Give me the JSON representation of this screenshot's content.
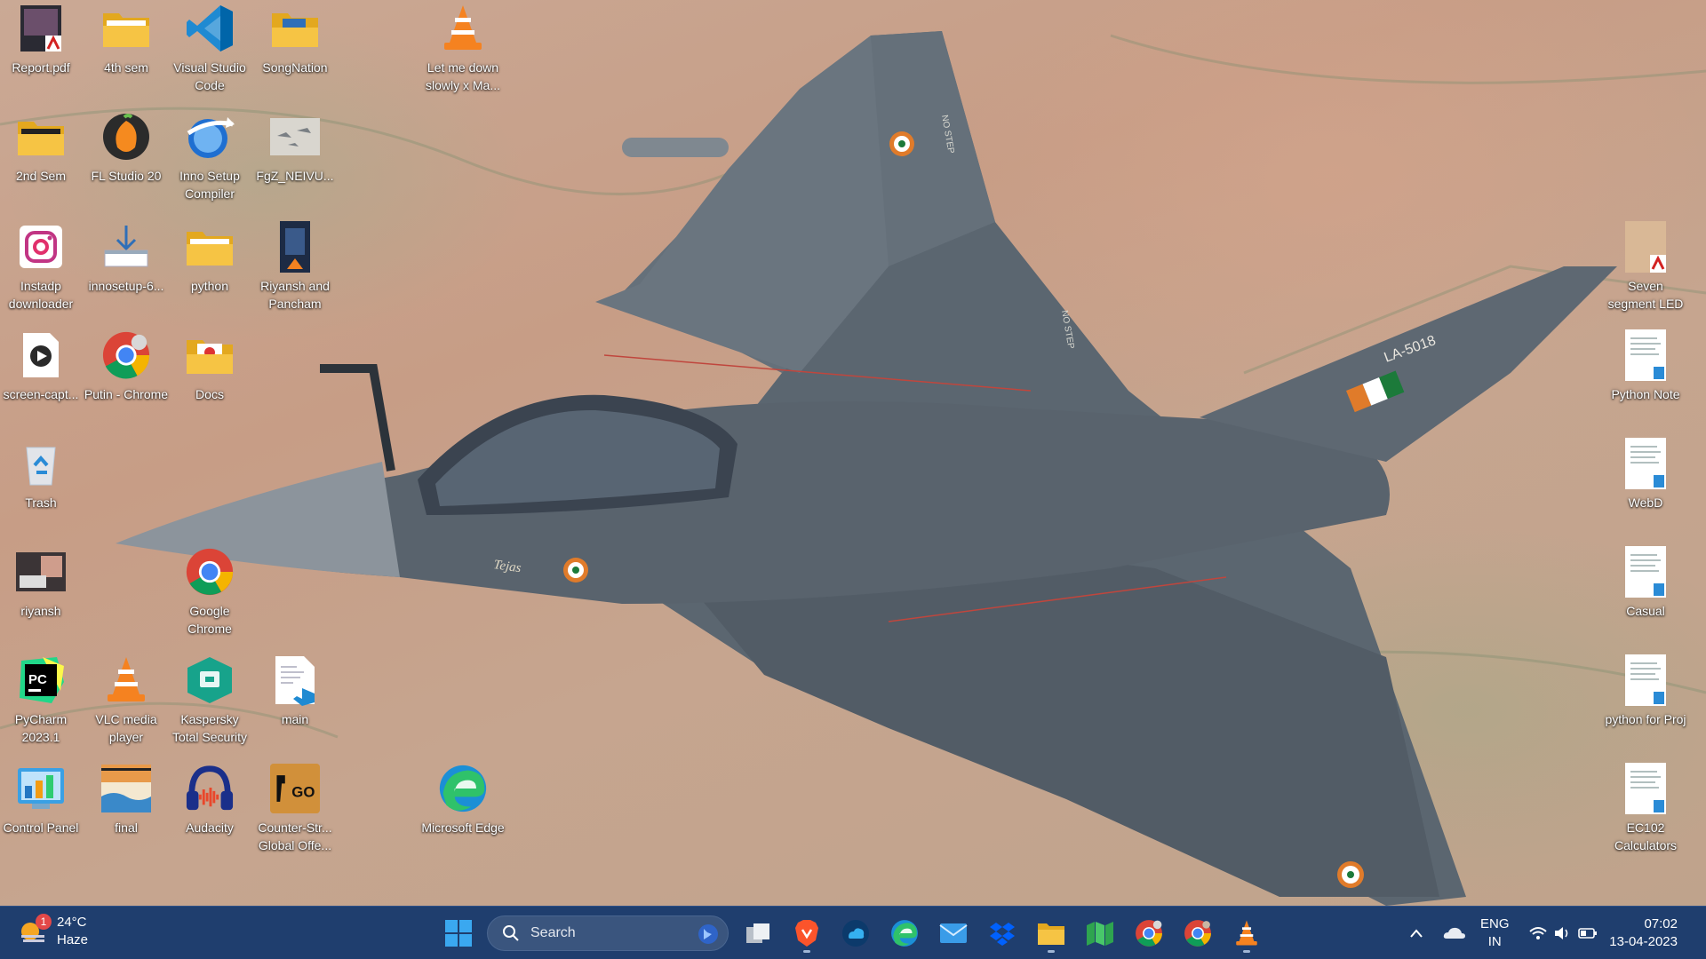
{
  "desktop": {
    "icons": {
      "report_pdf": "Report.pdf",
      "sem4": "4th sem",
      "vscode": "Visual Studio Code",
      "songnation": "SongNation",
      "vlc_song": "Let me down slowly x Ma...",
      "sem2": "2nd Sem",
      "flstudio": "FL Studio 20",
      "innosetup_compiler": "Inno Setup Compiler",
      "fgz": "FgZ_NEIVU...",
      "instadp": "Instadp downloader",
      "innosetup_installer": "innosetup-6...",
      "python_folder": "python",
      "riyansh_pancham": "Riyansh and Pancham",
      "screen_capture": "screen-capt...",
      "putin_chrome": "Putin - Chrome",
      "docs": "Docs",
      "trash": "Trash",
      "riyansh": "riyansh",
      "google_chrome": "Google Chrome",
      "pycharm": "PyCharm 2023.1",
      "vlc_player": "VLC media player",
      "kaspersky": "Kaspersky Total Security",
      "main": "main",
      "control_panel": "Control Panel",
      "final": "final",
      "audacity": "Audacity",
      "csgo": "Counter-Str... Global Offe...",
      "edge": "Microsoft Edge",
      "seven_segment": "Seven segment LED",
      "python_note": "Python Note",
      "webd": "WebD",
      "casual": "Casual",
      "python_for_proj": "python for Proj",
      "ec102": "EC102 Calculators"
    }
  },
  "wallpaper": {
    "aircraft_text": "LA-5018",
    "no_step_1": "NO STEP",
    "no_step_2": "NO STEP",
    "tejas": "Tejas"
  },
  "taskbar": {
    "weather": {
      "temp": "24°C",
      "condition": "Haze",
      "badge": "1"
    },
    "search_placeholder": "Search",
    "language": {
      "line1": "ENG",
      "line2": "IN"
    },
    "clock": {
      "time": "07:02",
      "date": "13-04-2023"
    }
  },
  "colors": {
    "taskbar_bg": "#1f3e6e",
    "search_bg": "#3a557e",
    "folder_yellow": "#f6c444",
    "jet_grey": "#5c6670"
  }
}
